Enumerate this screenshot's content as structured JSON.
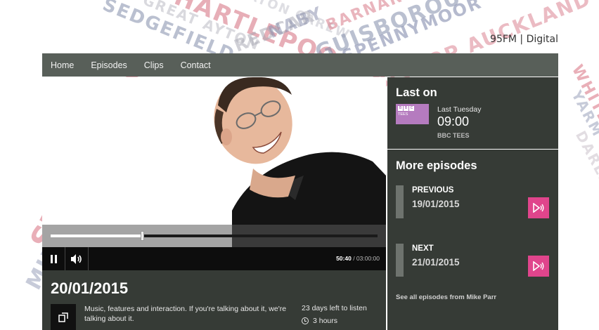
{
  "header": {
    "frequency": "95FM | Digital",
    "backdrop_words": [
      "SEDGEFIELD",
      "GREAT AYTON",
      "HARTLEPOOL",
      "REDCAR",
      "SEATON CAREW",
      "NABY",
      "GUISBOROUGH",
      "BARNARD",
      "SPENNYMOOR",
      "BISHOP AUCKLAND",
      "STOCKTON",
      "MIDDLESBROUGH",
      "WHITBY",
      "YARM",
      "DARLINGTON"
    ]
  },
  "nav": {
    "items": [
      "Home",
      "Episodes",
      "Clips",
      "Contact"
    ]
  },
  "player": {
    "elapsed": "50:40",
    "duration": "/ 03:00:00",
    "progress_fraction": 0.28,
    "pause_icon": "pause-icon",
    "volume_icon": "volume-icon"
  },
  "episode": {
    "date": "20/01/2015",
    "description": "Music, features and interaction. If you're talking about it, we're talking about it.",
    "days_left": "23 days left to listen",
    "duration": "3 hours",
    "popout_icon": "popout-icon",
    "clock_icon": "clock-icon"
  },
  "last_on": {
    "heading": "Last on",
    "station_logo_text": [
      "B",
      "B",
      "C"
    ],
    "station_logo_sub": "TEES",
    "when": "Last Tuesday",
    "time": "09:00",
    "station": "BBC TEES"
  },
  "more_episodes": {
    "heading": "More episodes",
    "previous": {
      "label": "PREVIOUS",
      "date": "19/01/2015"
    },
    "next": {
      "label": "NEXT",
      "date": "21/01/2015"
    },
    "see_all": "See all episodes from Mike Parr",
    "play_icon": "play-audio-icon"
  },
  "colors": {
    "panel": "#363b36",
    "nav": "#585f59",
    "accent_pink": "#e0458c",
    "station_purple": "#b57bbf"
  }
}
